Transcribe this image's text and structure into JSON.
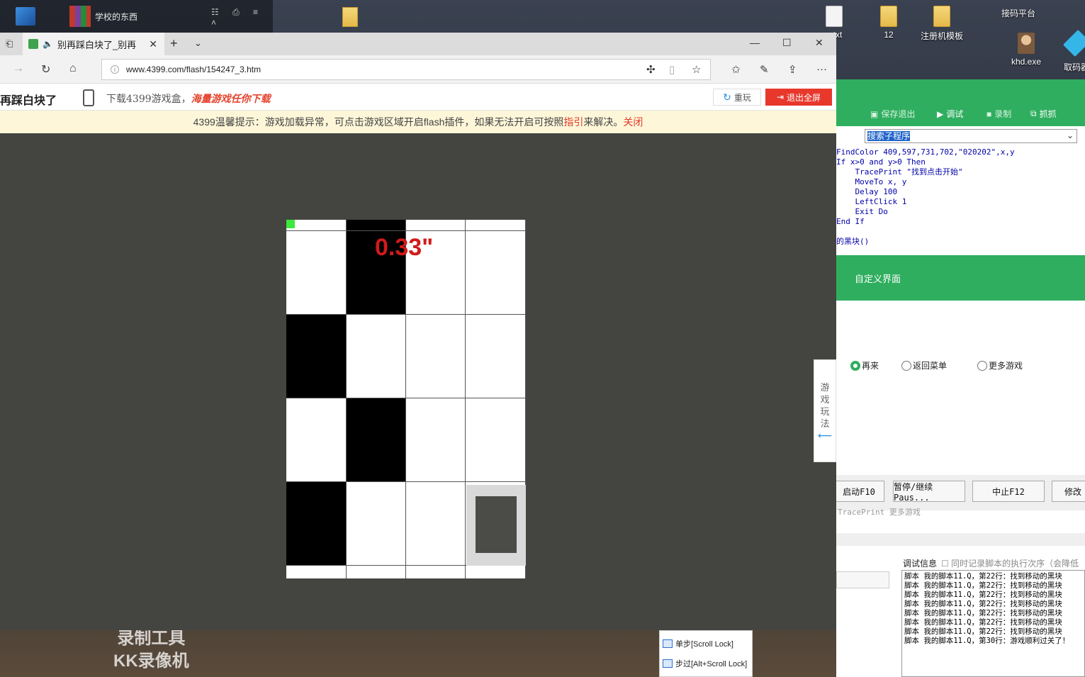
{
  "desktop": {
    "taskbar_app": "学校的东西",
    "icons": [
      {
        "label": "...txt",
        "type": "file"
      },
      {
        "label": "12",
        "type": "folder"
      },
      {
        "label": "注册机模板",
        "type": "folder"
      },
      {
        "label": "接码平台",
        "type": "text"
      },
      {
        "label": "khd.exe",
        "type": "user"
      },
      {
        "label": "取码器",
        "type": "diamond"
      }
    ]
  },
  "browser": {
    "tab_title": "别再踩白块了_别再",
    "url": "www.4399.com/flash/154247_3.htm"
  },
  "site": {
    "title": "再踩白块了",
    "download_prefix": "下载4399游戏盒，",
    "download_emph": "海量游戏任你下载",
    "replay_label": "重玩",
    "exit_fullscreen_label": "退出全屏"
  },
  "notice": {
    "text_before": "4399温馨提示：游戏加载异常，可点击游戏区域开启flash插件，如果无法开启可按照",
    "link_guide": "指引",
    "text_after": "来解决。",
    "link_close": "关闭"
  },
  "game": {
    "timer": "0.33\"",
    "grid": [
      [
        0,
        1,
        0,
        0
      ],
      [
        1,
        0,
        0,
        0
      ],
      [
        0,
        1,
        0,
        0
      ],
      [
        1,
        0,
        0,
        0
      ],
      [
        0,
        0,
        0,
        0
      ]
    ]
  },
  "howto": {
    "label": "游戏玩法"
  },
  "tool": {
    "toolbar": [
      "保存退出",
      "调试",
      "录制",
      "抓抓"
    ],
    "subroutine_select": "搜索子程序",
    "code_lines": [
      "FindColor 409,597,731,702,\"020202\",x,y",
      "If x>0 and y>0 Then",
      "    TracePrint \"找到点击开始\"",
      "    MoveTo x, y",
      "    Delay 100",
      "    LeftClick 1",
      "    Exit Do",
      "End If",
      "",
      "的黑块()"
    ],
    "custom_ui_label": "自定义界面",
    "radios": [
      "再来",
      "返回菜单",
      "更多游戏"
    ],
    "buttons": [
      "启动F10",
      "暂停/继续Paus...",
      "中止F12",
      "修改"
    ],
    "trace_line": "TracePrint  更多游戏",
    "debug_title": "调试信息",
    "debug_option": "同时记录脚本的执行次序（会降低",
    "debug_lines": [
      "脚本 我的脚本11.Q，第22行：找到移动的黑块",
      "脚本 我的脚本11.Q，第22行：找到移动的黑块",
      "脚本 我的脚本11.Q，第22行：找到移动的黑块",
      "脚本 我的脚本11.Q，第22行：找到移动的黑块",
      "脚本 我的脚本11.Q，第22行：找到移动的黑块",
      "脚本 我的脚本11.Q，第22行：找到移动的黑块",
      "脚本 我的脚本11.Q，第22行：找到移动的黑块",
      "脚本 我的脚本11.Q，第30行：游戏顺利过关了！"
    ],
    "step_items": [
      "单步[Scroll Lock]",
      "步过[Alt+Scroll Lock]"
    ]
  },
  "watermark": {
    "line1": "录制工具",
    "line2": "KK录像机"
  }
}
